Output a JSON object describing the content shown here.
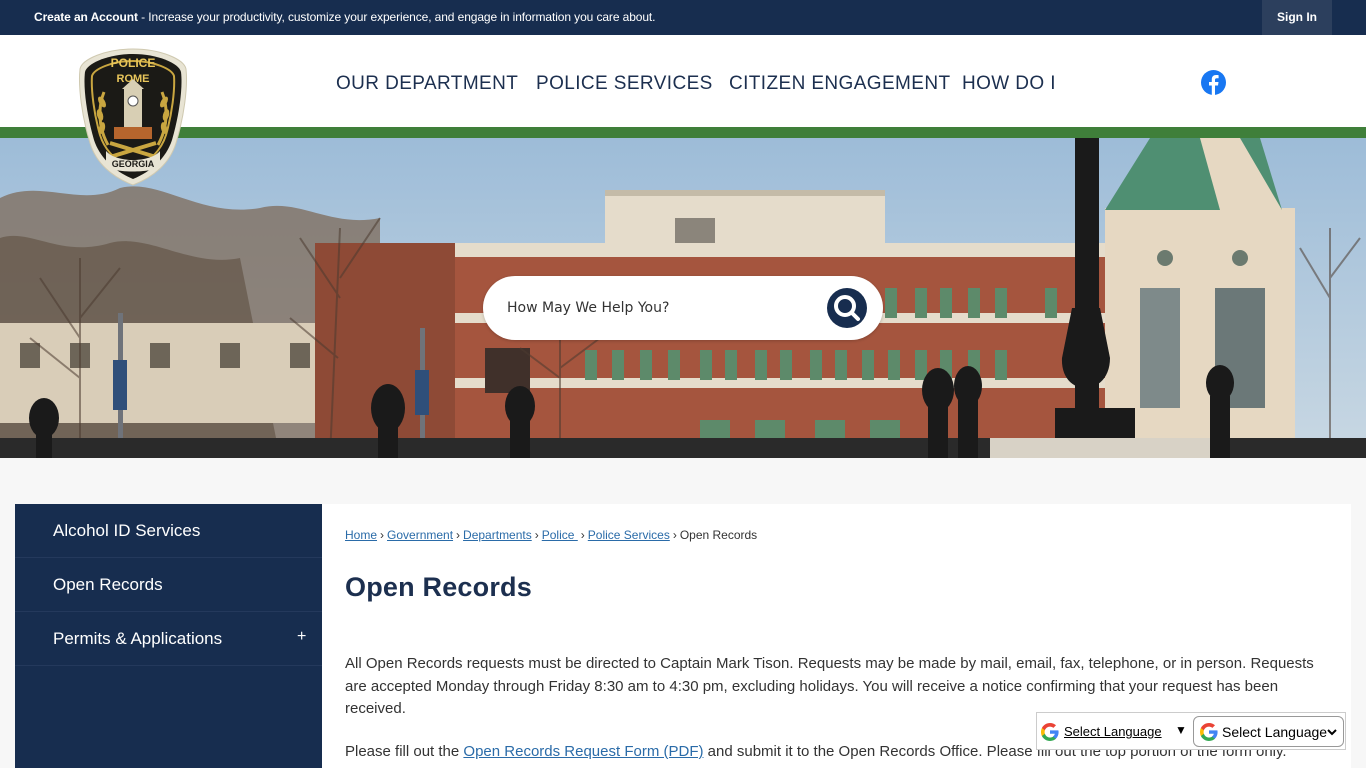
{
  "topbar": {
    "create_account": "Create an Account",
    "message": " - Increase your productivity, customize your experience, and engage in information you care about.",
    "sign_in": "Sign In"
  },
  "header": {
    "badge": {
      "top_text": "POLICE",
      "city": "ROME",
      "state": "GEORGIA"
    },
    "nav": [
      "OUR DEPARTMENT",
      "POLICE SERVICES",
      "CITIZEN ENGAGEMENT",
      "HOW DO I"
    ],
    "social_icon": "facebook-icon"
  },
  "search": {
    "placeholder": "How May We Help You?",
    "icon": "search-icon"
  },
  "sidebar": {
    "items": [
      {
        "label": "Alcohol ID Services"
      },
      {
        "label": "Open Records"
      },
      {
        "label": "Permits & Applications",
        "expand": "+"
      }
    ]
  },
  "breadcrumb": {
    "links": [
      "Home",
      "Government",
      "Departments",
      "Police ",
      "Police Services"
    ],
    "current": "Open Records"
  },
  "page": {
    "title": "Open Records",
    "paragraph1": "All Open Records requests must be directed to Captain Mark Tison. Requests may be made by mail, email, fax, telephone, or in person. Requests are accepted Monday through Friday 8:30 am to 4:30 pm, excluding holidays. You will receive a notice confirming that your request has been received.",
    "paragraph2_before": "Please fill out the ",
    "paragraph2_link": "Open Records Request Form (PDF)",
    "paragraph2_after": " and submit it to the Open Records Office. Please fill out the top portion of the form only."
  },
  "translate": {
    "label": "Select Language",
    "arrow": "▼",
    "select_value": "Select Language"
  },
  "colors": {
    "navy": "#172d4f",
    "green": "#3f7f3a",
    "link": "#2a6ba8"
  }
}
